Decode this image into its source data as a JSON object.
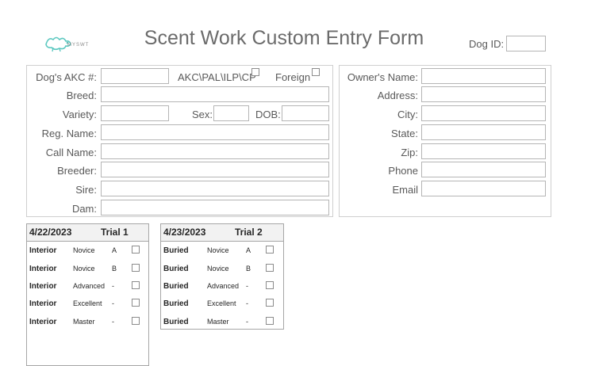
{
  "logo": {
    "text": "MYSWT"
  },
  "title": "Scent Work Custom Entry Form",
  "dog_id": {
    "label": "Dog ID:",
    "value": ""
  },
  "dog": {
    "akc_label": "Dog's AKC #:",
    "akc_value": "",
    "reg_type_label": "AKC\\PAL\\ILP\\CP",
    "foreign_label": "Foreign",
    "breed_label": "Breed:",
    "variety_label": "Variety:",
    "sex_label": "Sex:",
    "dob_label": "DOB:",
    "reg_name_label": "Reg. Name:",
    "call_name_label": "Call Name:",
    "breeder_label": "Breeder:",
    "sire_label": "Sire:",
    "dam_label": "Dam:"
  },
  "owner": {
    "name_label": "Owner's Name:",
    "address_label": "Address:",
    "city_label": "City:",
    "state_label": "State:",
    "zip_label": "Zip:",
    "phone_label": "Phone",
    "email_label": "Email"
  },
  "trials": [
    {
      "date": "4/22/2023",
      "name": "Trial 1",
      "rows": [
        {
          "cls": "Interior",
          "level": "Novice",
          "section": "A"
        },
        {
          "cls": "Interior",
          "level": "Novice",
          "section": "B"
        },
        {
          "cls": "Interior",
          "level": "Advanced",
          "section": "-"
        },
        {
          "cls": "Interior",
          "level": "Excellent",
          "section": "-"
        },
        {
          "cls": "Interior",
          "level": "Master",
          "section": "-"
        }
      ]
    },
    {
      "date": "4/23/2023",
      "name": "Trial 2",
      "rows": [
        {
          "cls": "Buried",
          "level": "Novice",
          "section": "A"
        },
        {
          "cls": "Buried",
          "level": "Novice",
          "section": "B"
        },
        {
          "cls": "Buried",
          "level": "Advanced",
          "section": "-"
        },
        {
          "cls": "Buried",
          "level": "Excellent",
          "section": "-"
        },
        {
          "cls": "Buried",
          "level": "Master",
          "section": "-"
        }
      ]
    }
  ]
}
